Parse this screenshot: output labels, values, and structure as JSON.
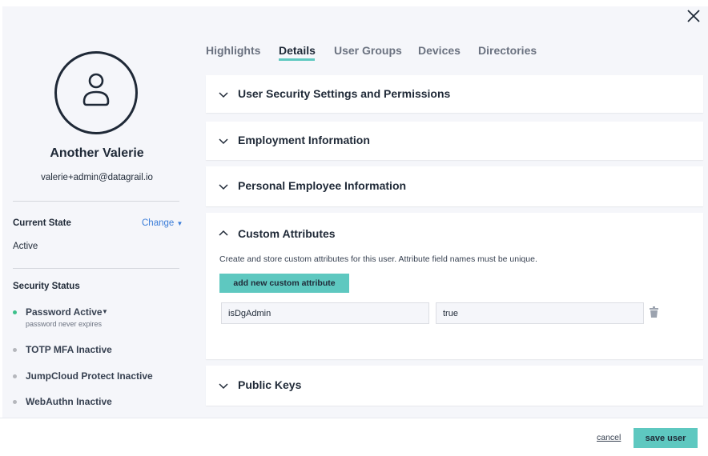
{
  "user": {
    "name": "Another Valerie",
    "email": "valerie+admin@datagrail.io"
  },
  "state": {
    "label": "Current State",
    "change": "Change",
    "value": "Active"
  },
  "security": {
    "label": "Security Status",
    "items": [
      {
        "label": "Password Active",
        "sub": "password never expires",
        "status": "active"
      },
      {
        "label": "TOTP MFA Inactive",
        "status": "inactive"
      },
      {
        "label": "JumpCloud Protect Inactive",
        "status": "inactive"
      },
      {
        "label": "WebAuthn Inactive",
        "status": "inactive"
      }
    ]
  },
  "tabs": [
    {
      "label": "Highlights"
    },
    {
      "label": "Details",
      "active": true
    },
    {
      "label": "User Groups"
    },
    {
      "label": "Devices"
    },
    {
      "label": "Directories"
    }
  ],
  "sections": [
    {
      "title": "User Security Settings and Permissions",
      "expanded": false
    },
    {
      "title": "Employment Information",
      "expanded": false
    },
    {
      "title": "Personal Employee Information",
      "expanded": false
    },
    {
      "title": "Custom Attributes",
      "expanded": true
    },
    {
      "title": "Public Keys",
      "expanded": false
    }
  ],
  "custom": {
    "description": "Create and store custom attributes for this user. Attribute field names must be unique.",
    "add_label": "add new custom attribute",
    "attributes": [
      {
        "name": "isDgAdmin",
        "value": "true"
      }
    ]
  },
  "footer": {
    "cancel": "cancel",
    "save": "save user"
  },
  "colors": {
    "accent": "#5ec8c0",
    "link": "#3b7dd8",
    "active_dot": "#3cc08a"
  }
}
